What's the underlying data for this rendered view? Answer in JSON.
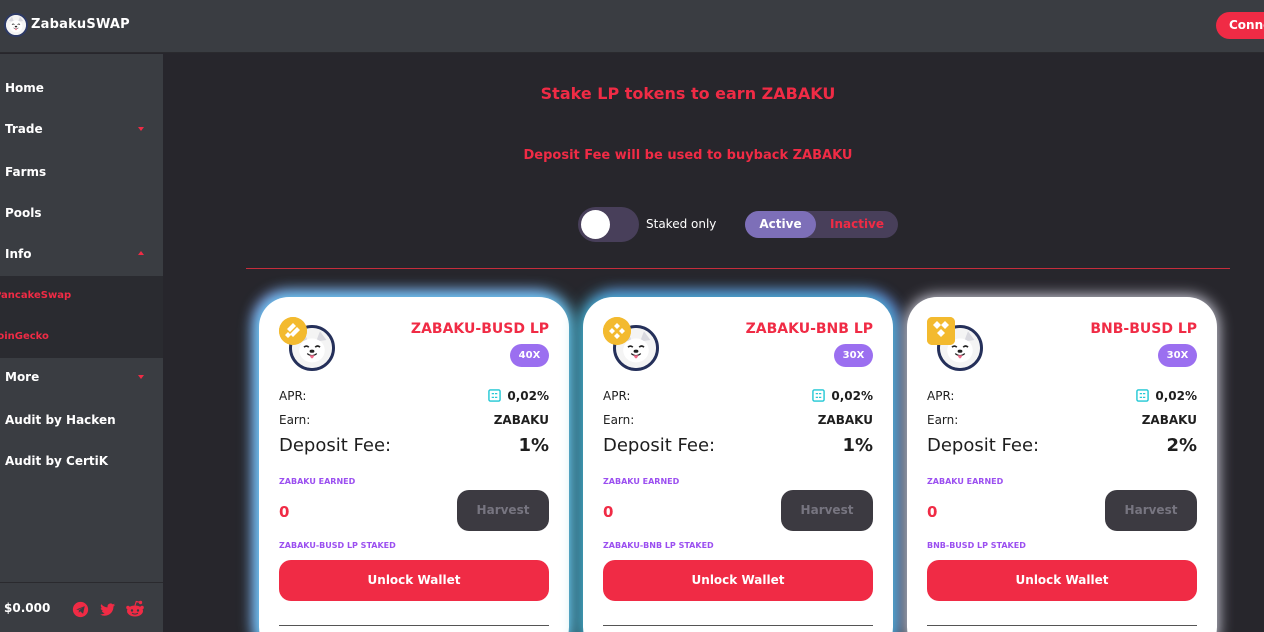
{
  "header": {
    "brand": "ZabakuSWAP",
    "connect_label": "Connect",
    "logo_icon": "zabaku-dog-logo-icon"
  },
  "sidebar": {
    "items": [
      {
        "label": "Home"
      },
      {
        "label": "Trade",
        "caret": "down"
      },
      {
        "label": "Farms"
      },
      {
        "label": "Pools"
      },
      {
        "label": "Info",
        "caret": "up"
      },
      {
        "label": "More",
        "caret": "down"
      },
      {
        "label": "Audit by Hacken"
      },
      {
        "label": "Audit by CertiK"
      }
    ],
    "submenu": [
      {
        "label": "PancakeSwap"
      },
      {
        "label": "CoinGecko"
      }
    ],
    "footer": {
      "price": "$0.000",
      "icons": [
        "telegram-icon",
        "twitter-icon",
        "reddit-icon"
      ]
    }
  },
  "main": {
    "heading": "Stake LP tokens to earn ZABAKU",
    "subheading": "Deposit Fee will be used to buyback ZABAKU",
    "staked_only_label": "Staked only",
    "staked_only_on": false,
    "tabs": {
      "active": "Active",
      "inactive": "Inactive"
    }
  },
  "cards": [
    {
      "pair": "ZABAKU-BUSD LP",
      "multiplier": "40X",
      "apr_label": "APR:",
      "apr_value": "0,02%",
      "earn_label": "Earn:",
      "earn_value": "ZABAKU",
      "fee_label": "Deposit Fee:",
      "fee_value": "1%",
      "earned_label": "ZABAKU EARNED",
      "earned_value": "0",
      "harvest_label": "Harvest",
      "staked_label": "ZABAKU-BUSD LP STAKED",
      "unlock_label": "Unlock Wallet",
      "quote_icon": "busd-coin-icon"
    },
    {
      "pair": "ZABAKU-BNB LP",
      "multiplier": "30X",
      "apr_label": "APR:",
      "apr_value": "0,02%",
      "earn_label": "Earn:",
      "earn_value": "ZABAKU",
      "fee_label": "Deposit Fee:",
      "fee_value": "1%",
      "earned_label": "ZABAKU EARNED",
      "earned_value": "0",
      "harvest_label": "Harvest",
      "staked_label": "ZABAKU-BNB LP STAKED",
      "unlock_label": "Unlock Wallet",
      "quote_icon": "bnb-coin-icon"
    },
    {
      "pair": "BNB-BUSD LP",
      "multiplier": "30X",
      "apr_label": "APR:",
      "apr_value": "0,02%",
      "earn_label": "Earn:",
      "earn_value": "ZABAKU",
      "fee_label": "Deposit Fee:",
      "fee_value": "2%",
      "earned_label": "ZABAKU EARNED",
      "earned_value": "0",
      "harvest_label": "Harvest",
      "staked_label": "BNB-BUSD LP STAKED",
      "unlock_label": "Unlock Wallet",
      "quote_icon": "bnb-busd-coin-icon"
    }
  ],
  "colors": {
    "accent": "#f02b45",
    "purple": "#9b6ff0",
    "panel": "#3a3d42",
    "background": "#27262c"
  }
}
